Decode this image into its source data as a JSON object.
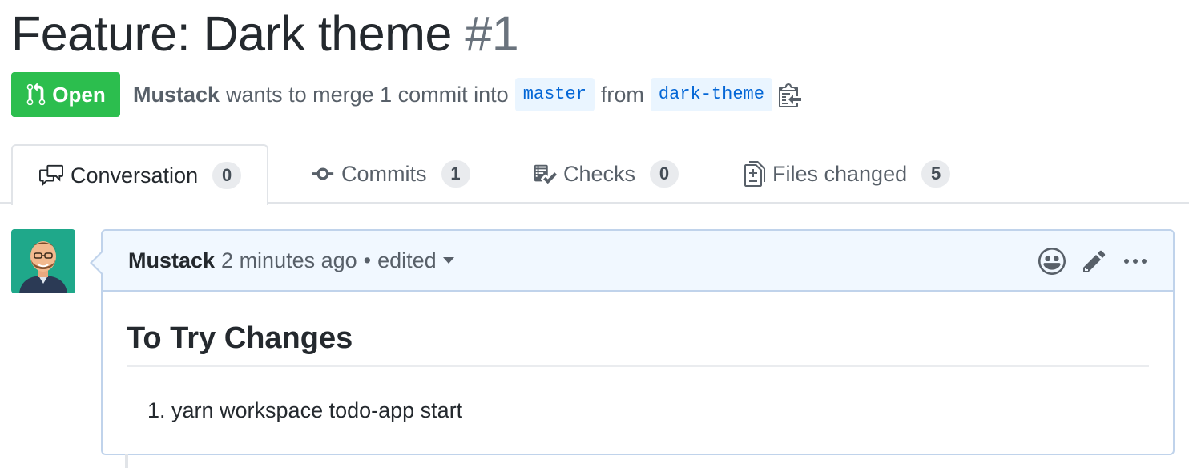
{
  "pr": {
    "title": "Feature: Dark theme",
    "number": "#1",
    "state": "Open",
    "author": "Mustack",
    "merge_text": "wants to merge 1 commit into",
    "base_branch": "master",
    "from_text": "from",
    "head_branch": "dark-theme"
  },
  "tabs": [
    {
      "label": "Conversation",
      "count": "0",
      "icon": "comment-discussion-icon",
      "selected": true
    },
    {
      "label": "Commits",
      "count": "1",
      "icon": "git-commit-icon"
    },
    {
      "label": "Checks",
      "count": "0",
      "icon": "checklist-icon"
    },
    {
      "label": "Files changed",
      "count": "5",
      "icon": "file-diff-icon"
    }
  ],
  "comment": {
    "author": "Mustack",
    "timestamp": "2 minutes ago",
    "separator": "•",
    "edited": "edited",
    "heading": "To Try Changes",
    "list": [
      "yarn workspace todo-app start"
    ]
  },
  "colors": {
    "open_green": "#2cbe4e",
    "link_blue": "#0366d6",
    "branch_bg": "#eaf5ff",
    "comment_header_bg": "#f1f8ff",
    "comment_border": "#c0d3eb"
  }
}
